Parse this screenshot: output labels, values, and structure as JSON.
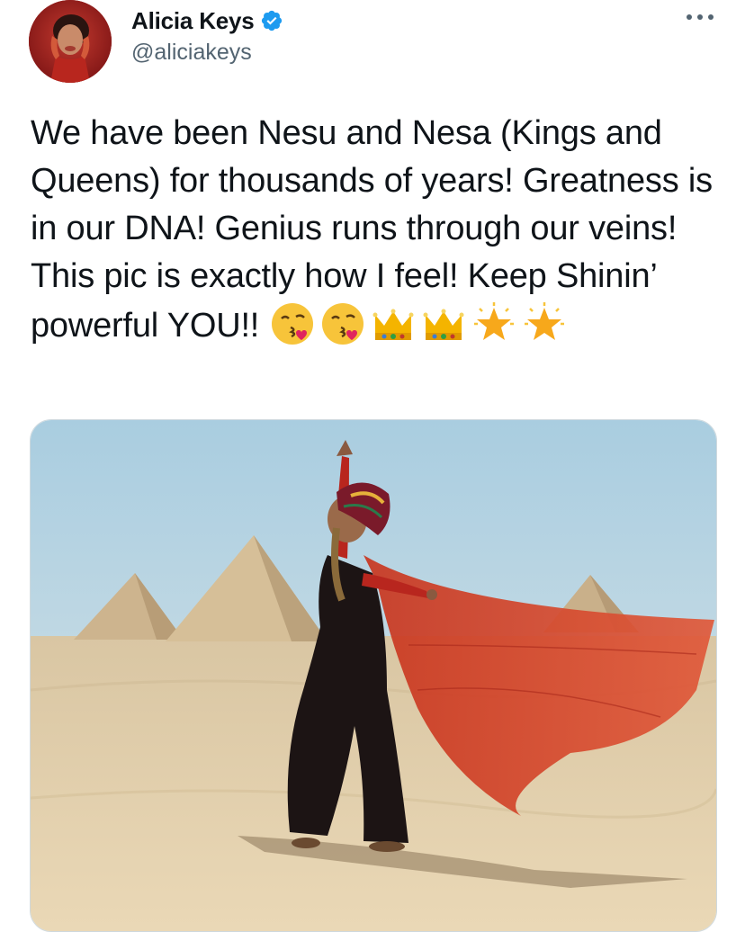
{
  "user": {
    "display_name": "Alicia Keys",
    "handle": "@aliciakeys",
    "verified": true
  },
  "tweet": {
    "text": "We have been Nesu and Nesa (Kings and Queens) for thousands of years! Greatness is in our DNA! Genius runs through our veins! This pic is exactly how I feel! Keep Shinin’ powerful YOU!! ",
    "emojis": [
      "face-blowing-kiss",
      "face-blowing-kiss",
      "crown",
      "crown",
      "glowing-star",
      "glowing-star"
    ]
  },
  "icons": {
    "more": "more-dots-icon",
    "verified": "verified-badge-icon"
  },
  "colors": {
    "verified_blue": "#1d9bf0",
    "text": "#0f1419",
    "secondary": "#536471",
    "media_border": "#cfd9de"
  }
}
